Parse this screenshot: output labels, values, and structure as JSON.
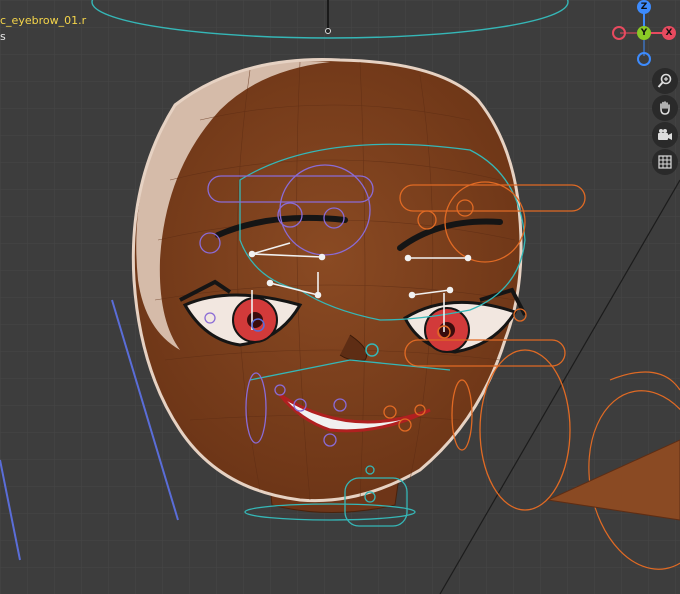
{
  "hud": {
    "active_bone": "c_eyebrow_01.r",
    "line2": "s"
  },
  "gizmo": {
    "z_label": "Z",
    "y_label": "Y",
    "x_label": "X",
    "colors": {
      "x": "#e84a5f",
      "y": "#8ac926",
      "z": "#3d8bfd"
    }
  },
  "navigation": {
    "zoom_icon": "zoom-icon",
    "pan_icon": "hand-pan-icon",
    "camera_icon": "camera-view-icon",
    "ortho_icon": "grid-ortho-icon"
  },
  "colors": {
    "background": "#3d3d3d",
    "grid": "#474747",
    "skin": "#7a3f1f",
    "skin_wire": "#5e2d14",
    "hair_edge": "#e6d2c3",
    "rig_cyan": "#35b7b7",
    "rig_purple": "#8a6bd6",
    "rig_orange": "#e06a24",
    "rig_blue": "#5a6dd8",
    "bone_white": "#f1f1f1",
    "eye_red": "#d23a3a"
  }
}
